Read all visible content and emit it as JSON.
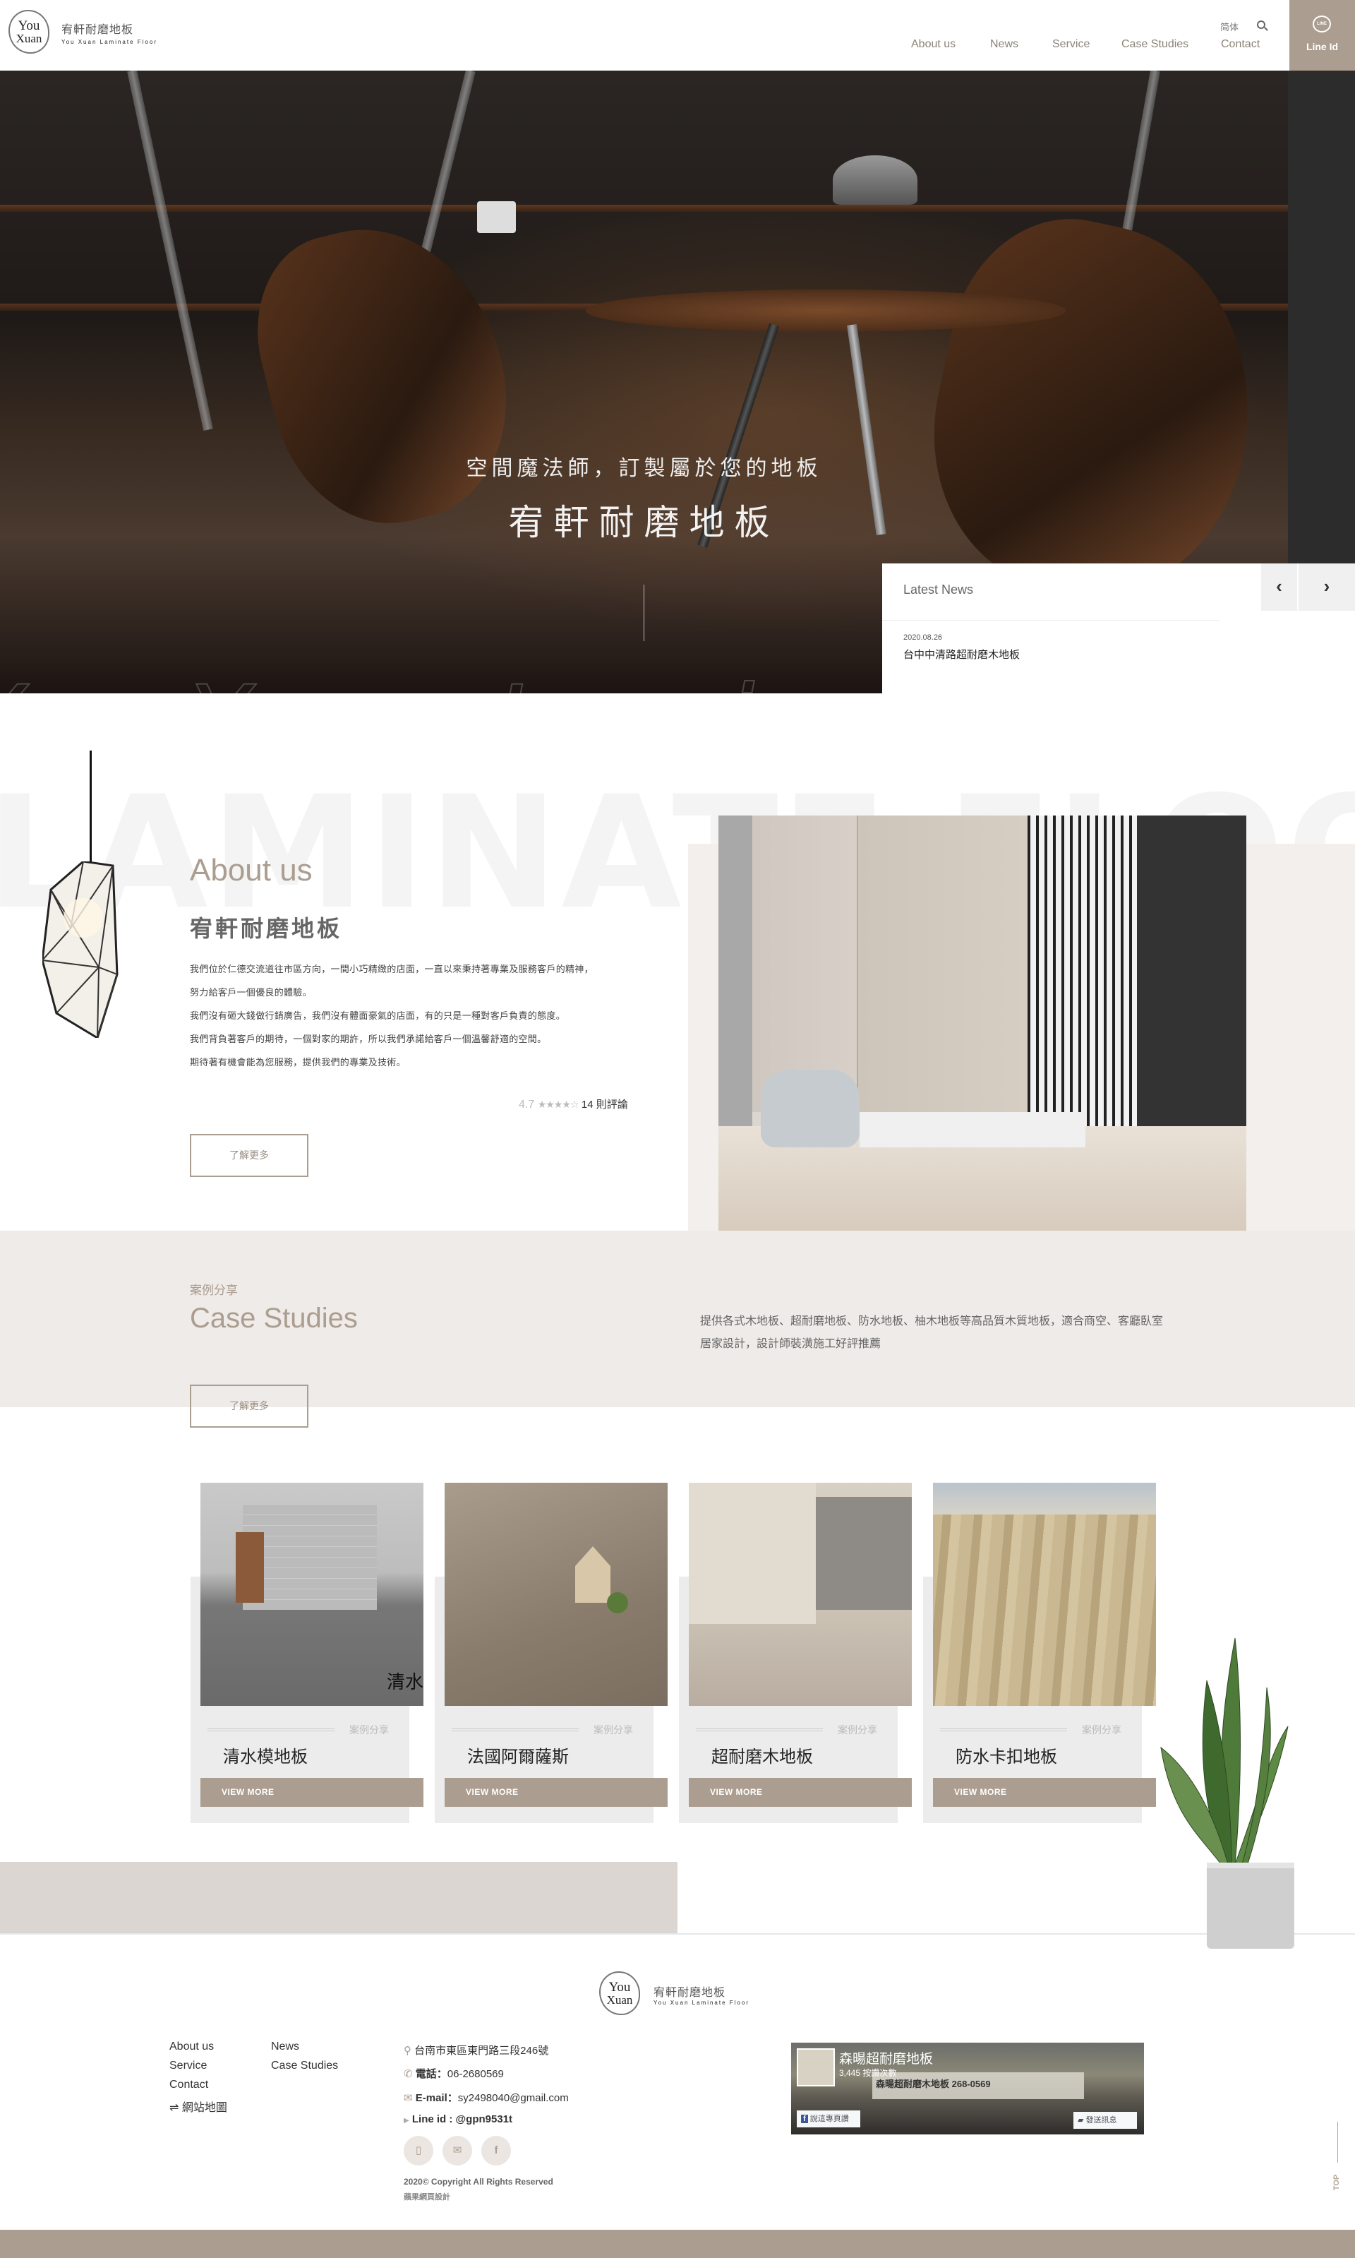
{
  "header": {
    "logo": {
      "line1": "You",
      "line2": "Xuan",
      "name_cn": "宥軒耐磨地板",
      "name_en": "You Xuan Laminate Floor"
    },
    "nav": [
      {
        "label": "About us"
      },
      {
        "label": "News"
      },
      {
        "label": "Service"
      },
      {
        "label": "Case Studies"
      },
      {
        "label": "Contact"
      }
    ],
    "lang_label": "简体",
    "search_icon": "search-icon",
    "line_button": {
      "icon": "line-bubble-icon",
      "icon_text": "LINE",
      "label": "Line Id"
    }
  },
  "hero": {
    "subtitle": "空間魔法師，訂製屬於您的地板",
    "title": "宥軒耐磨地板",
    "watermark": "You Xuan Laminate",
    "slides": {
      "count": 3,
      "active_index": 3
    }
  },
  "news": {
    "title": "Latest News",
    "prev_icon": "‹",
    "next_icon": "›",
    "items": [
      {
        "date": "2020.08.26",
        "headline": "台中中清路超耐磨木地板"
      }
    ]
  },
  "about": {
    "watermark": "LAMINATE FLOOR",
    "title": "About us",
    "subtitle": "宥軒耐磨地板",
    "paragraphs": [
      "我們位於仁德交流道往市區方向，一間小巧精緻的店面，一直以來秉持著專業及服務客戶的精神，",
      "努力給客戶一個優良的體驗。",
      "我們沒有砸大錢做行銷廣告，我們沒有體面豪氣的店面，有的只是一種對客戶負責的態度。",
      "我們背負著客戶的期待，一個對家的期許，所以我們承諾給客戶一個溫馨舒適的空間。",
      "期待著有機會能為您服務，提供我們的專業及技術。"
    ],
    "rating": {
      "score": "4.7",
      "stars_text": "★★★★☆",
      "reviews": "14 則評論"
    },
    "more_button": "了解更多"
  },
  "case_studies": {
    "label": "案例分享",
    "title": "Case Studies",
    "description": "提供各式木地板、超耐磨地板、防水地板、柚木地板等高品質木質地板，適合商空、客廳臥室居家設計，設計師裝潢施工好評推薦",
    "more_button": "了解更多",
    "cards": [
      {
        "tag": "案例分享",
        "name": "清水模地板",
        "image_caption": "清水",
        "button": "VIEW MORE"
      },
      {
        "tag": "案例分享",
        "name": "法國阿爾薩斯",
        "image_caption": "",
        "button": "VIEW MORE"
      },
      {
        "tag": "案例分享",
        "name": "超耐磨木地板",
        "image_caption": "",
        "button": "VIEW MORE"
      },
      {
        "tag": "案例分享",
        "name": "防水卡扣地板",
        "image_caption": "",
        "button": "VIEW MORE"
      }
    ]
  },
  "footer": {
    "logo": {
      "line1": "You",
      "line2": "Xuan",
      "name_cn": "宥軒耐磨地板",
      "name_en": "You Xuan Laminate Floor"
    },
    "links_col1": [
      "About us",
      "Service",
      "Contact"
    ],
    "links_col2": [
      "News",
      "Case Studies"
    ],
    "sitemap": "網站地圖",
    "contact": {
      "address": "台南市東區東門路三段246號",
      "phone_label": "電話：",
      "phone": "06-2680569",
      "email_label": "E-mail：",
      "email": "sy2498040@gmail.com",
      "line": "Line id : @gpn9531t"
    },
    "social": [
      {
        "icon": "phone-icon",
        "glyph": "▯"
      },
      {
        "icon": "mail-icon",
        "glyph": "✉"
      },
      {
        "icon": "facebook-icon",
        "glyph": "f"
      }
    ],
    "copyright": "2020© Copyright All Rights Reserved",
    "credit": "蘋果網頁設計",
    "facebook_widget": {
      "page_name": "森暘超耐磨地板",
      "likes": "3,445 按讚次數",
      "sign_text": "森暘超耐磨木地板  268-0569",
      "like_button": "說這專頁讚",
      "message_button": "發送訊息"
    },
    "top_button": "TOP"
  },
  "colors": {
    "accent": "#ab9d90",
    "band": "#efebe8",
    "card_bg": "#ececec",
    "grey_block": "#dbd6d2"
  }
}
